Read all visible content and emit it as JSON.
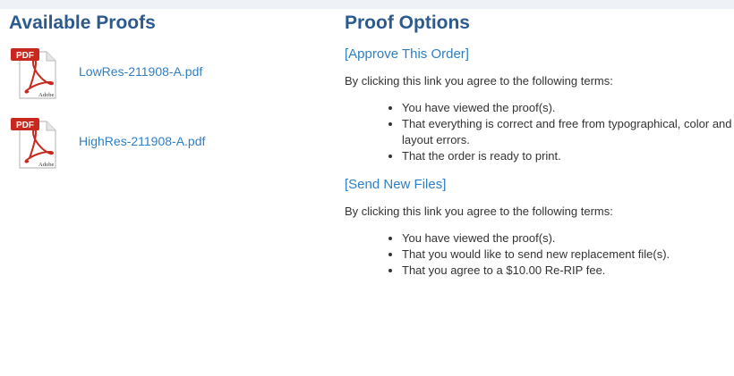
{
  "available_proofs": {
    "title": "Available Proofs",
    "files": [
      {
        "name": "LowRes-211908-A.pdf",
        "icon": "pdf-file-icon",
        "badge": "PDF",
        "brand": "Adobe"
      },
      {
        "name": "HighRes-211908-A.pdf",
        "icon": "pdf-file-icon",
        "badge": "PDF",
        "brand": "Adobe"
      }
    ]
  },
  "proof_options": {
    "title": "Proof Options",
    "approve": {
      "link": "[Approve This Order]",
      "intro": "By clicking this link you agree to the following terms:",
      "terms": [
        "You have viewed the proof(s).",
        "That everything is correct and free from typographical, color and layout errors.",
        "That the order is ready to print."
      ]
    },
    "send_new": {
      "link": "[Send New Files]",
      "intro": "By clicking this link you agree to the following terms:",
      "terms": [
        "You have viewed the proof(s).",
        "That you would like to send new replacement file(s).",
        "That you agree to a $10.00 Re-RIP fee."
      ]
    }
  },
  "colors": {
    "heading": "#2b5a8f",
    "link": "#2f7fc4",
    "pdf_badge": "#c8281e"
  }
}
